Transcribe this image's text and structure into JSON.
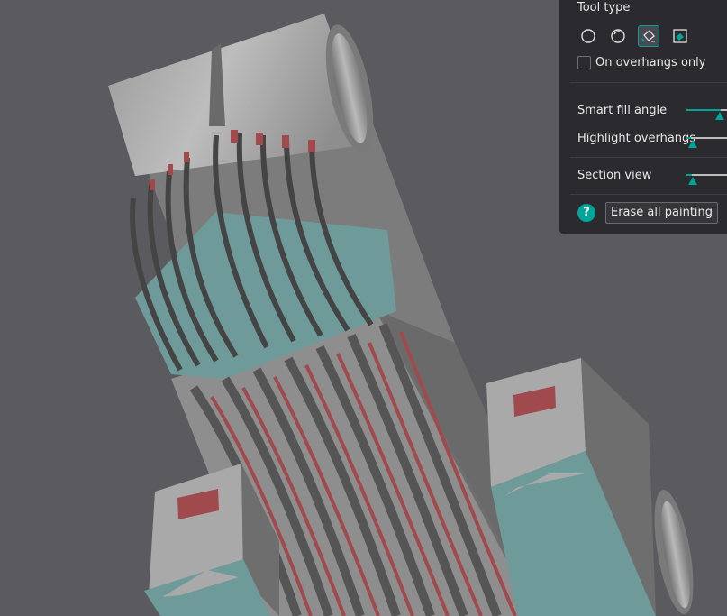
{
  "panel": {
    "tool_type_label": "Tool type",
    "tools": [
      {
        "icon": "circle-brush-icon",
        "active": false
      },
      {
        "icon": "sphere-brush-icon",
        "active": false
      },
      {
        "icon": "fill-bucket-icon",
        "active": true
      },
      {
        "icon": "gap-fill-icon",
        "active": false
      }
    ],
    "overhangs_only_label": "On overhangs only",
    "overhangs_only_checked": false,
    "smart_fill_angle_label": "Smart fill angle",
    "highlight_overhangs_label": "Highlight overhangs",
    "section_view_label": "Section view",
    "help_label": "?",
    "erase_all_label": "Erase all painting"
  },
  "colors": {
    "background": "#5b5b5f",
    "panel": "#2b2b2f",
    "accent": "#00a59a",
    "model_gray": "#8c8c8c",
    "paint_red": "#a04a4e",
    "paint_teal": "#6e9a9a"
  }
}
